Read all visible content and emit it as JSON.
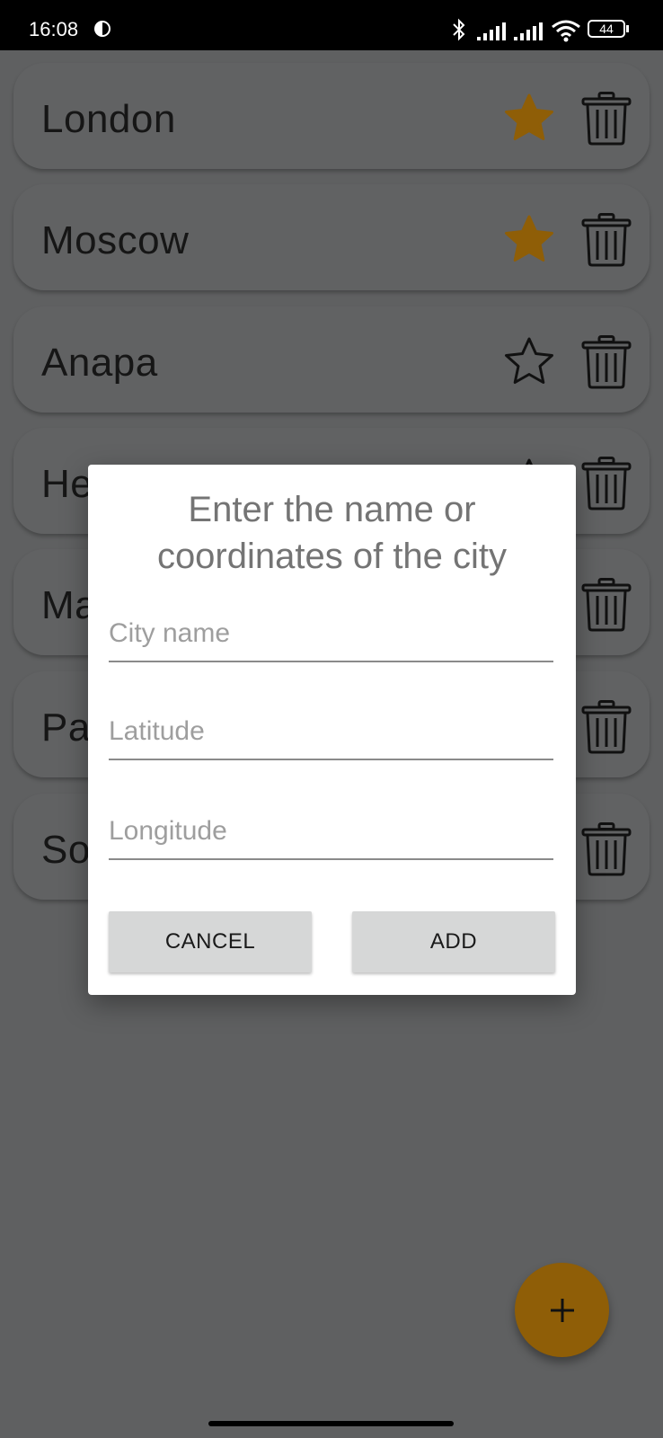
{
  "status_bar": {
    "time": "16:08",
    "battery": "44"
  },
  "cities": [
    {
      "name": "London",
      "favorite": true
    },
    {
      "name": "Moscow",
      "favorite": true
    },
    {
      "name": "Anapa",
      "favorite": false
    },
    {
      "name": "He",
      "favorite": false
    },
    {
      "name": "Ma",
      "favorite": false
    },
    {
      "name": "Pa",
      "favorite": false
    },
    {
      "name": "So",
      "favorite": false
    }
  ],
  "dialog": {
    "title_line1": "Enter the name or",
    "title_line2": "coordinates of the city",
    "city_placeholder": "City name",
    "latitude_placeholder": "Latitude",
    "longitude_placeholder": "Longitude",
    "cancel_label": "CANCEL",
    "add_label": "ADD"
  },
  "fab": {
    "label": "+"
  },
  "colors": {
    "accent": "#8f5e07",
    "scrim_background": "#5f6061",
    "dialog_background": "#ffffff"
  }
}
